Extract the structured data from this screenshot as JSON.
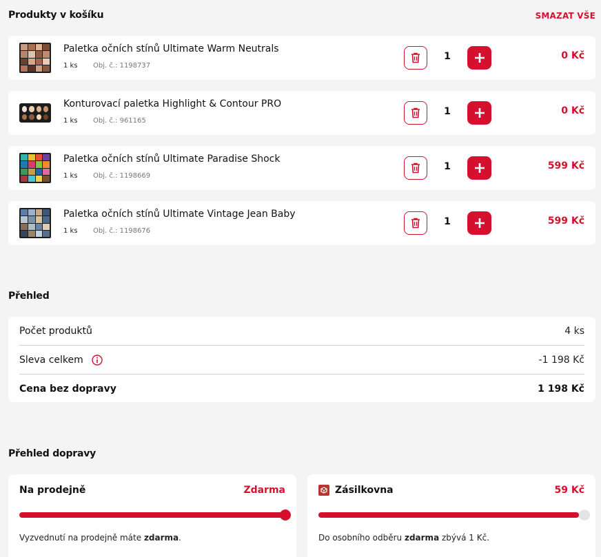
{
  "cart": {
    "title": "Produkty v košíku",
    "clear_all_label": "SMAZAT VŠE",
    "items": [
      {
        "name": "Paletka očních stínů Ultimate Warm Neutrals",
        "qty_unit": "1 ks",
        "code": "Obj. č.: 1198737",
        "quantity": "1",
        "price": "0 Kč"
      },
      {
        "name": "Konturovací paletka Highlight & Contour PRO",
        "qty_unit": "1 ks",
        "code": "Obj. č.: 961165",
        "quantity": "1",
        "price": "0 Kč"
      },
      {
        "name": "Paletka očních stínů Ultimate Paradise Shock",
        "qty_unit": "1 ks",
        "code": "Obj. č.: 1198669",
        "quantity": "1",
        "price": "599 Kč"
      },
      {
        "name": "Paletka očních stínů Ultimate Vintage Jean Baby",
        "qty_unit": "1 ks",
        "code": "Obj. č.: 1198676",
        "quantity": "1",
        "price": "599 Kč"
      }
    ]
  },
  "overview": {
    "title": "Přehled",
    "rows": [
      {
        "label": "Počet produktů",
        "value": "4 ks"
      },
      {
        "label": "Sleva celkem",
        "value": "-1 198 Kč"
      },
      {
        "label": "Cena bez dopravy",
        "value": "1 198 Kč"
      }
    ]
  },
  "shipping": {
    "title": "Přehled dopravy",
    "options": [
      {
        "name": "Na prodejně",
        "price": "Zdarma",
        "note_prefix": "Vyzvednutí na prodejně máte ",
        "note_bold": "zdarma",
        "note_suffix": ".",
        "progress": 1.0
      },
      {
        "name": "Zásilkovna",
        "price": "59 Kč",
        "note_prefix": "Do osobního odběru ",
        "note_bold": "zdarma",
        "note_suffix": " zbývá 1 Kč.",
        "progress": 0.98
      }
    ]
  },
  "colors": {
    "accent": "#d5102f",
    "muted": "#777777",
    "track": "#e4e4e4",
    "card": "#ffffff",
    "background": "#f4f4f4"
  },
  "icons": {
    "delete": "trash-icon",
    "increase": "plus-icon",
    "info": "info-icon",
    "carrier": "zasilkovna-logo-icon"
  }
}
